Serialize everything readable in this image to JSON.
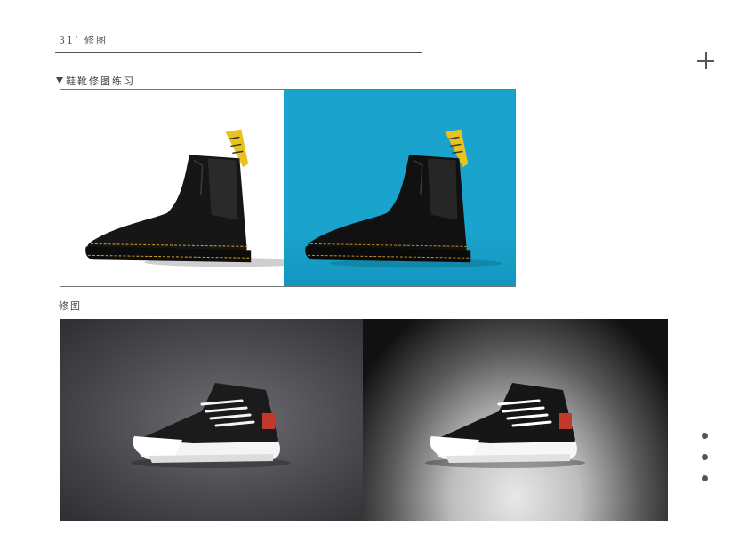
{
  "header": {
    "title": "31’ 修图"
  },
  "section1": {
    "heading": "鞋靴修图练习"
  },
  "section2": {
    "heading": "修图"
  },
  "colors": {
    "accent_blue": "#1aa3cc",
    "line": "#555555"
  },
  "icons": {
    "add": "plus-icon",
    "bullet": "triangle-down-icon"
  },
  "pager": {
    "count": 3
  }
}
